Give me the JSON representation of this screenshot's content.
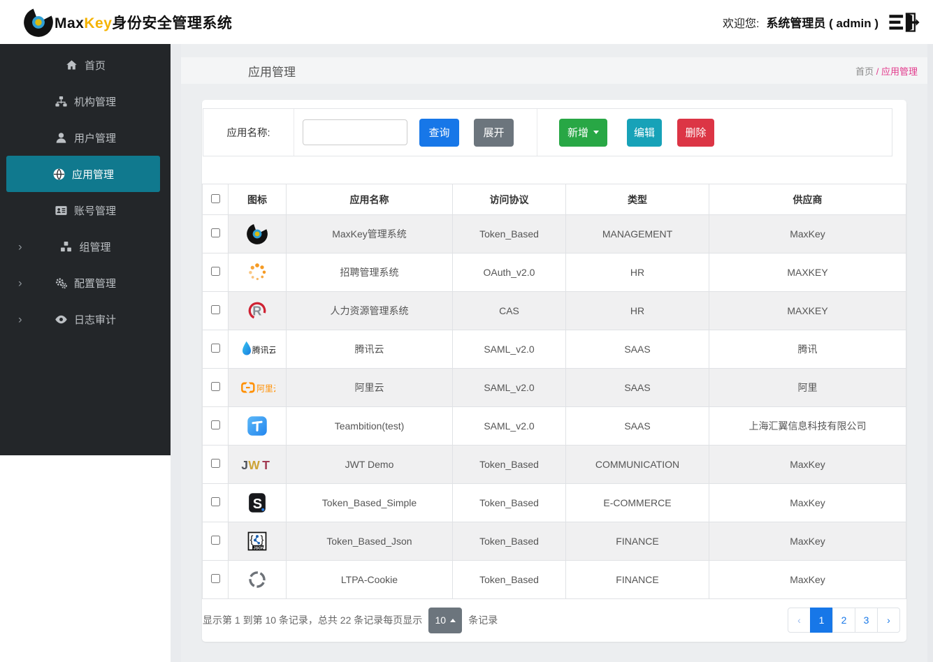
{
  "colors": {
    "primary": "#1777e8",
    "success": "#28a745",
    "info": "#17a2b8",
    "danger": "#dc3545",
    "secondary": "#6c757d",
    "sidebar-active": "#10798e",
    "pink": "#e23a8c",
    "gold": "#f5b301"
  },
  "brand": {
    "name_part1": "Max",
    "name_part2": "Key",
    "name_cn": "身份安全管理系统",
    "logo_icon": "maxkey-logo"
  },
  "header": {
    "welcome_label": "欢迎您:",
    "user_name": "系统管理员 ( admin )",
    "logout_icon": "logout-door-icon"
  },
  "sidebar": {
    "items": [
      {
        "id": "home",
        "label": "首页",
        "icon": "home-icon",
        "active": false,
        "expandable": false
      },
      {
        "id": "org",
        "label": "机构管理",
        "icon": "sitemap-icon",
        "active": false,
        "expandable": false
      },
      {
        "id": "user",
        "label": "用户管理",
        "icon": "user-icon",
        "active": false,
        "expandable": false
      },
      {
        "id": "app",
        "label": "应用管理",
        "icon": "globe-icon",
        "active": true,
        "expandable": false
      },
      {
        "id": "account",
        "label": "账号管理",
        "icon": "id-card-icon",
        "active": false,
        "expandable": false
      },
      {
        "id": "group",
        "label": "组管理",
        "icon": "cubes-icon",
        "active": false,
        "expandable": true
      },
      {
        "id": "config",
        "label": "配置管理",
        "icon": "gears-icon",
        "active": false,
        "expandable": true
      },
      {
        "id": "audit",
        "label": "日志审计",
        "icon": "eye-icon",
        "active": false,
        "expandable": true
      }
    ]
  },
  "page": {
    "title": "应用管理",
    "breadcrumb": {
      "root": "首页",
      "sep": "/",
      "current": "应用管理"
    }
  },
  "toolbar": {
    "search_label": "应用名称:",
    "search_value": "",
    "query_label": "查询",
    "expand_label": "展开",
    "add_label": "新增",
    "edit_label": "编辑",
    "delete_label": "删除"
  },
  "table": {
    "columns": {
      "icon": "图标",
      "name": "应用名称",
      "protocol": "访问协议",
      "type": "类型",
      "vendor": "供应商"
    },
    "rows": [
      {
        "icon": "maxkey-logo",
        "name": "MaxKey管理系统",
        "protocol": "Token_Based",
        "type": "MANAGEMENT",
        "vendor": "MaxKey"
      },
      {
        "icon": "spinner-dots-icon",
        "name": "招聘管理系统",
        "protocol": "OAuth_v2.0",
        "type": "HR",
        "vendor": "MAXKEY"
      },
      {
        "icon": "hr-logo",
        "name": "人力资源管理系统",
        "protocol": "CAS",
        "type": "HR",
        "vendor": "MAXKEY"
      },
      {
        "icon": "tencent-cloud-logo",
        "name": "腾讯云",
        "protocol": "SAML_v2.0",
        "type": "SAAS",
        "vendor": "腾讯"
      },
      {
        "icon": "aliyun-logo",
        "name": "阿里云",
        "protocol": "SAML_v2.0",
        "type": "SAAS",
        "vendor": "阿里"
      },
      {
        "icon": "teambition-logo",
        "name": "Teambition(test)",
        "protocol": "SAML_v2.0",
        "type": "SAAS",
        "vendor": "上海汇翼信息科技有限公司"
      },
      {
        "icon": "jwt-logo",
        "name": "JWT Demo",
        "protocol": "Token_Based",
        "type": "COMMUNICATION",
        "vendor": "MaxKey"
      },
      {
        "icon": "letter-s-logo",
        "name": "Token_Based_Simple",
        "protocol": "Token_Based",
        "type": "E-COMMERCE",
        "vendor": "MaxKey"
      },
      {
        "icon": "json-logo",
        "name": "Token_Based_Json",
        "protocol": "Token_Based",
        "type": "FINANCE",
        "vendor": "MaxKey"
      },
      {
        "icon": "target-circle-icon",
        "name": "LTPA-Cookie",
        "protocol": "Token_Based",
        "type": "FINANCE",
        "vendor": "MaxKey"
      }
    ]
  },
  "pagination": {
    "summary": "显示第 1 到第 10 条记录，总共 22 条记录",
    "per_page_label": "每页显示",
    "per_page_value": "10",
    "records_suffix": "条记录",
    "prev": "‹",
    "next": "›",
    "pages": [
      "1",
      "2",
      "3"
    ],
    "active_page": "1"
  }
}
